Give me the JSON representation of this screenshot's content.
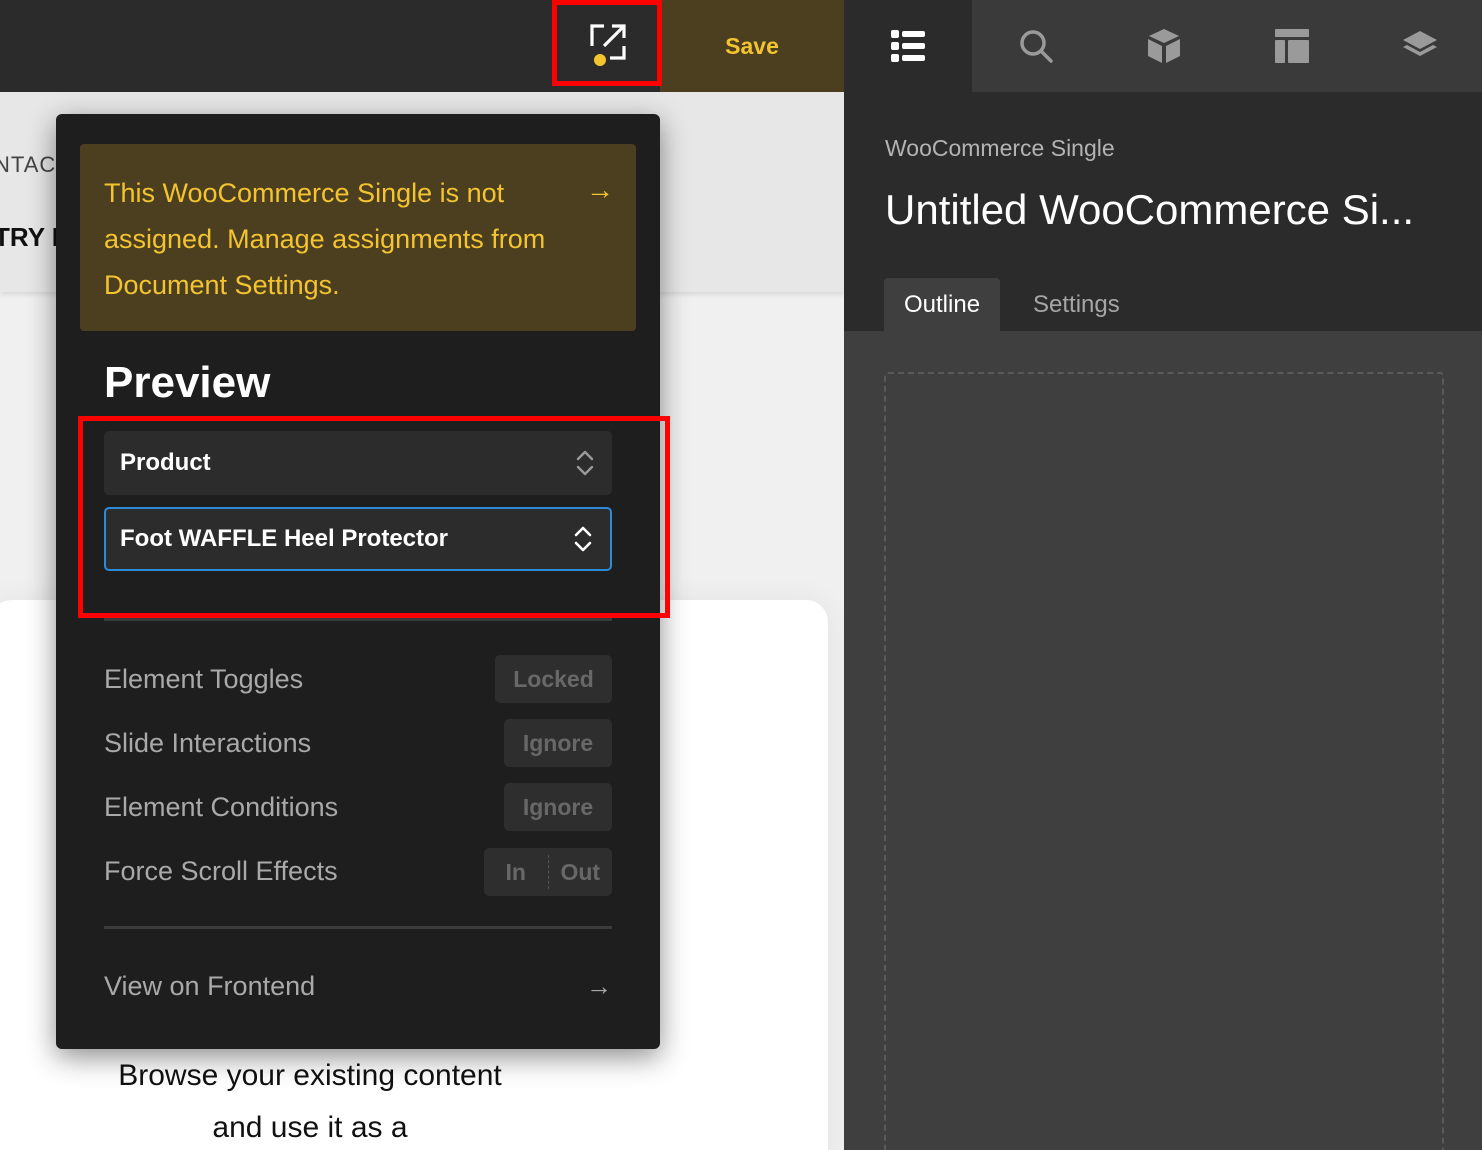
{
  "colors": {
    "accent_yellow": "#f4c430",
    "highlight_red": "#ff0000",
    "focus_blue": "#2d8ad8",
    "notice_bg": "#4b3f20"
  },
  "toolbar": {
    "preview_toggle_icon": "external-preview-icon",
    "save_label": "Save"
  },
  "canvas": {
    "nav_text_1": "NTACT",
    "nav_text_2": "TRY I",
    "body_text": "Browse your existing content and use it as a"
  },
  "popup": {
    "notice_text": "This WooCommerce Single is not assigned. Manage assignments from Document Settings.",
    "notice_arrow": "→",
    "title": "Preview",
    "selects": {
      "type": "Product",
      "item": "Foot WAFFLE Heel Protector"
    },
    "rows": [
      {
        "label": "Element Toggles",
        "value": "Locked"
      },
      {
        "label": "Slide Interactions",
        "value": "Ignore"
      },
      {
        "label": "Element Conditions",
        "value": "Ignore"
      },
      {
        "label": "Force Scroll Effects",
        "value_in": "In",
        "value_out": "Out"
      }
    ],
    "view_frontend": "View on Frontend",
    "view_frontend_arrow": "→"
  },
  "right_panel": {
    "icon_tabs": [
      "list-icon",
      "search-icon",
      "cube-icon",
      "layout-icon",
      "layers-icon"
    ],
    "subtitle": "WooCommerce Single",
    "title": "Untitled WooCommerce Si...",
    "tabs": [
      "Outline",
      "Settings"
    ]
  }
}
